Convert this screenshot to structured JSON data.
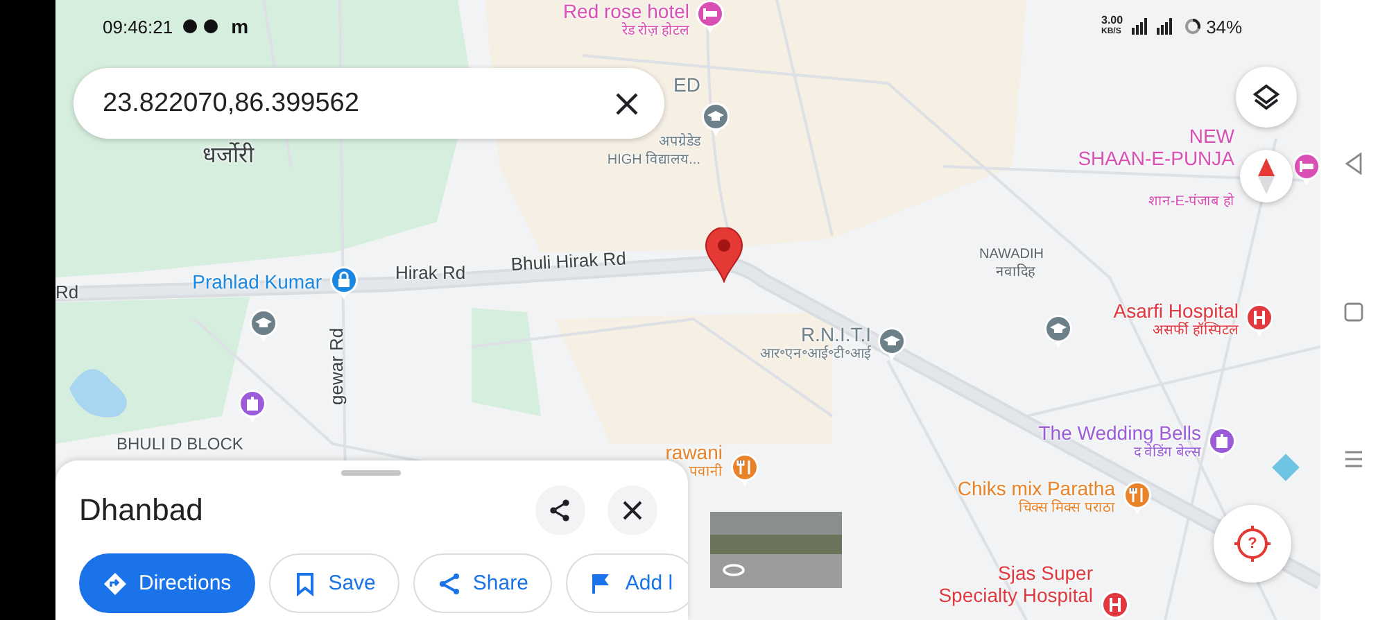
{
  "status_bar": {
    "time": "09:46:21",
    "app_icon": "m",
    "speed": "3.00",
    "speed_unit": "KB/S",
    "battery": "34%"
  },
  "search": {
    "value": "23.822070,86.399562"
  },
  "map": {
    "places": [
      {
        "text": "धर्जोरी"
      },
      {
        "text": "NAWADIH"
      },
      {
        "text": "नवादिह"
      },
      {
        "text": "BHULI D BLOCK"
      }
    ],
    "roads": [
      {
        "text": "Rd"
      },
      {
        "text": "Hirak Rd"
      },
      {
        "text": "Bhuli Hirak Rd"
      },
      {
        "text": "gewar Rd"
      }
    ],
    "pois": [
      {
        "kind": "hotel",
        "color": "#d94fb4",
        "lines": [
          "Red rose hotel",
          "रेड रोज़ होटल"
        ]
      },
      {
        "kind": "school",
        "color": "#6d7f88",
        "lines": [
          "ED",
          "अपग्रेडेड",
          "HIGH विद्यालय..."
        ]
      },
      {
        "kind": "hotel",
        "color": "#d94fb4",
        "lines": [
          "NEW",
          "SHAAN-E-PUNJA",
          "शान-E-पंजाब हो"
        ]
      },
      {
        "kind": "lock",
        "color": "#1a88e0",
        "lines": [
          "Prahlad Kumar"
        ]
      },
      {
        "kind": "hospital",
        "color": "#e0383e",
        "lines": [
          "Asarfi Hospital",
          "असर्फी हॉस्पिटल"
        ]
      },
      {
        "kind": "school",
        "color": "#6d7f88",
        "lines": [
          "R.N.I.T.I",
          "आर॰एन॰आई॰टी॰आई"
        ]
      },
      {
        "kind": "venue",
        "color": "#9c5bd8",
        "lines": [
          "The Wedding Bells",
          "द वेडिंग बेल्स"
        ]
      },
      {
        "kind": "restaurant",
        "color": "#e8832a",
        "lines": [
          "rawani",
          "पवानी"
        ]
      },
      {
        "kind": "restaurant",
        "color": "#e8832a",
        "lines": [
          "Chiks mix Paratha",
          "चिक्स मिक्स पराठा"
        ]
      },
      {
        "kind": "hospital",
        "color": "#e0383e",
        "lines": [
          "Sjas Super",
          "Specialty Hospital"
        ]
      }
    ],
    "pins": [
      {
        "kind": "school",
        "color": "#6d7f88"
      },
      {
        "kind": "school",
        "color": "#6d7f88"
      },
      {
        "kind": "venue",
        "color": "#9c5bd8"
      }
    ]
  },
  "locate_button": {
    "label": "?"
  },
  "place_sheet": {
    "title": "Dhanbad",
    "actions": [
      {
        "kind": "directions",
        "label": "Directions"
      },
      {
        "kind": "save",
        "label": "Save"
      },
      {
        "kind": "share",
        "label": "Share"
      },
      {
        "kind": "label",
        "label": "Add l"
      }
    ]
  }
}
